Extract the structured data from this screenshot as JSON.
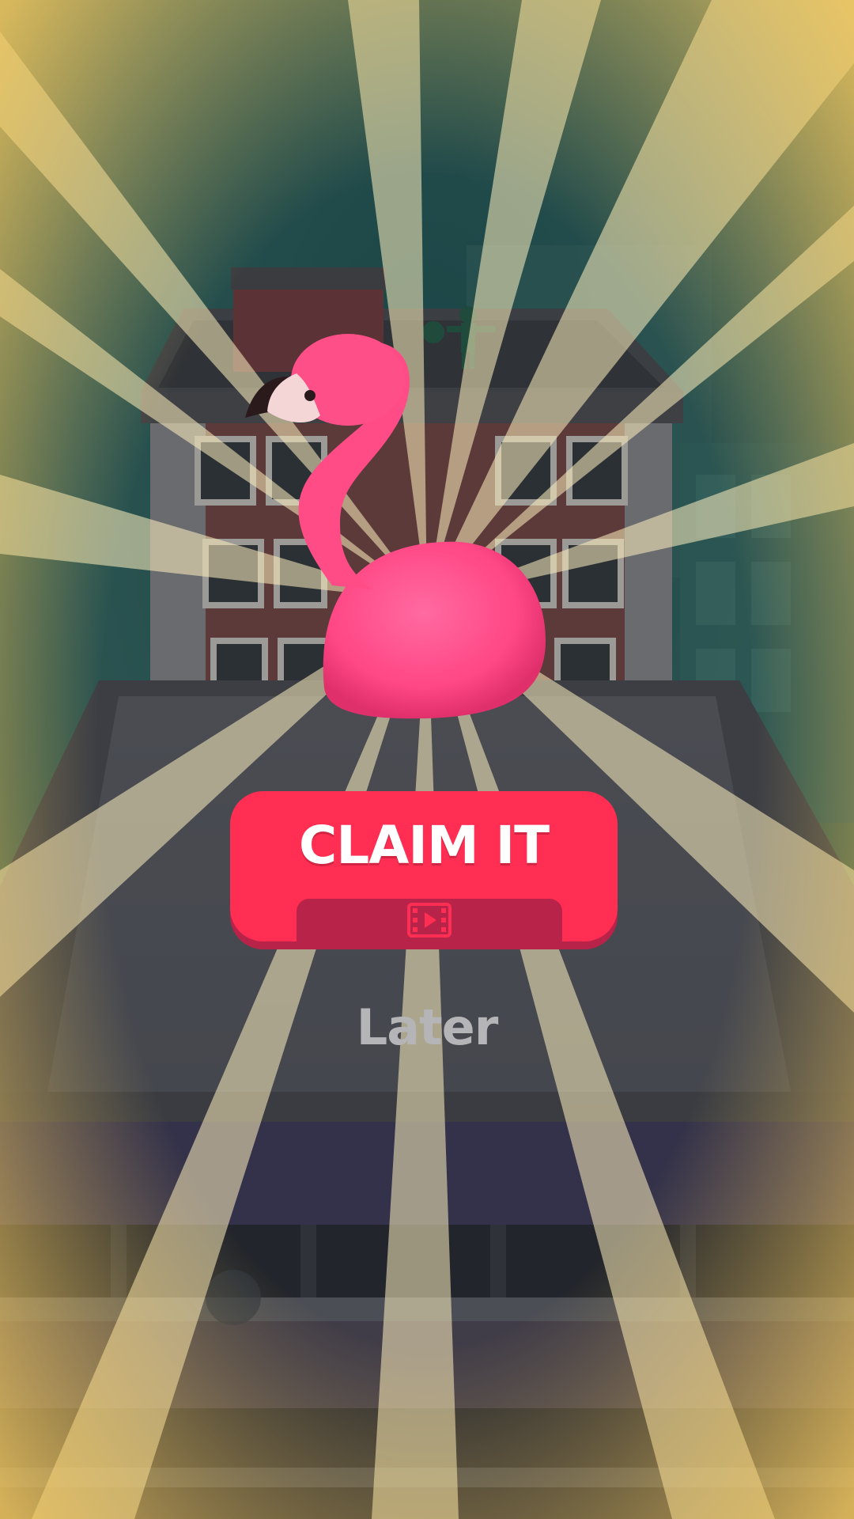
{
  "reward_popup": {
    "claim_button_label": "CLAIM IT",
    "claim_button_icon": "video-ad-icon",
    "later_label": "Later"
  },
  "colors": {
    "claim_button": "#ff2e52",
    "claim_button_shadow": "#b8234a",
    "later_text": "#b5b5b8",
    "sunburst": "#f2d07a",
    "flamingo": "#ff4b86"
  }
}
